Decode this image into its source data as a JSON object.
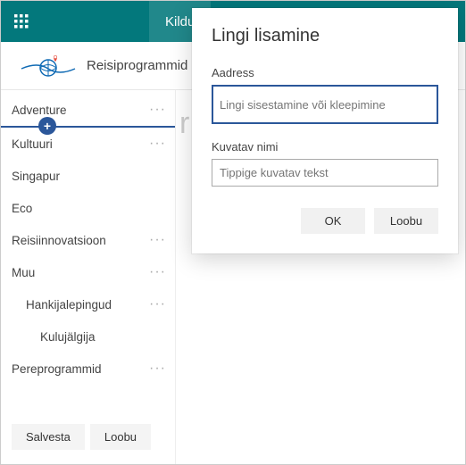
{
  "topbar": {
    "tab_label": "Kildu"
  },
  "brand": {
    "title": "Reisiprogrammid"
  },
  "sidebar": {
    "items": [
      {
        "label": "Adventure"
      },
      {
        "label": "Kultuuri"
      },
      {
        "label": "Singapur"
      },
      {
        "label": "Eco"
      },
      {
        "label": "Reisiinnovatsioon"
      },
      {
        "label": "Muu"
      },
      {
        "label": "Hankijalepingud"
      },
      {
        "label": "Kulujälgija"
      },
      {
        "label": "Pereprogrammid"
      }
    ],
    "save_label": "Salvesta",
    "cancel_label": "Loobu"
  },
  "dialog": {
    "title": "Lingi lisamine",
    "address_label": "Aadress",
    "address_placeholder": "Lingi sisestamine või kleepimine",
    "display_label": "Kuvatav nimi",
    "display_placeholder": "Tippige kuvatav tekst",
    "ok_label": "OK",
    "cancel_label": "Loobu"
  }
}
